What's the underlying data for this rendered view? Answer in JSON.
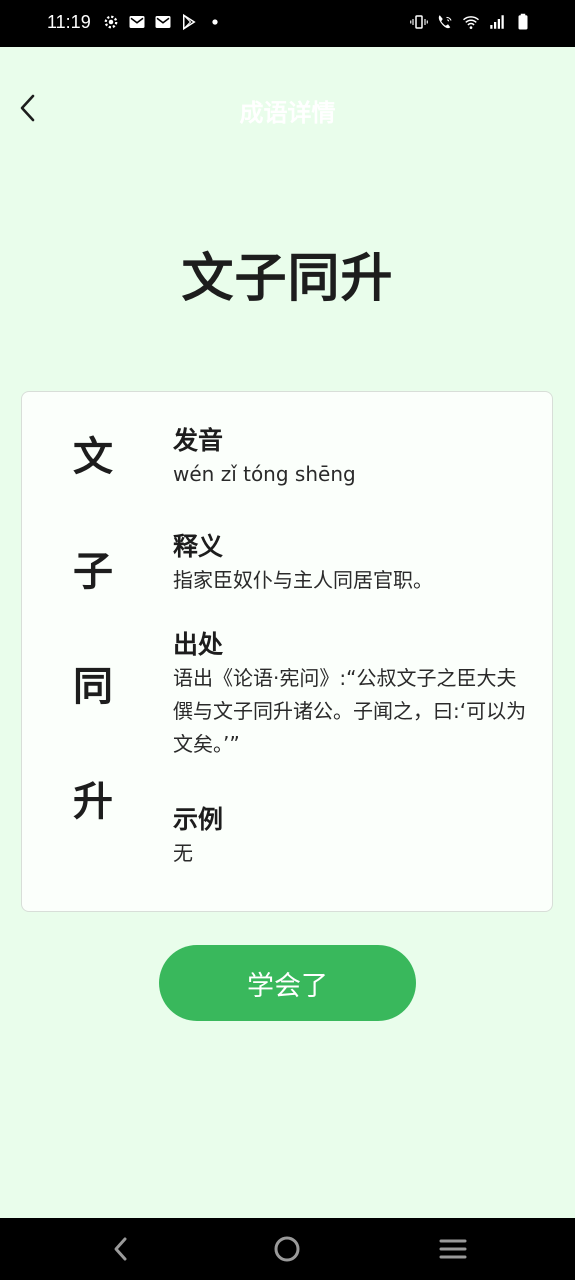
{
  "status_bar": {
    "time": "11:19",
    "left_icons": [
      "gear-icon",
      "mail-icon",
      "mail-icon",
      "play-store-icon",
      "dot-icon"
    ],
    "right_icons": [
      "vibrate-icon",
      "wifi-call-icon",
      "wifi-icon",
      "signal-icon",
      "battery-icon"
    ]
  },
  "header": {
    "title": "成语详情"
  },
  "idiom": {
    "text": "文子同升",
    "chars": [
      "文",
      "子",
      "同",
      "升"
    ]
  },
  "sections": {
    "pronunciation": {
      "heading": "发音",
      "body": "wén zǐ tóng shēng"
    },
    "meaning": {
      "heading": "释义",
      "body": "指家臣奴仆与主人同居官职。"
    },
    "source": {
      "heading": "出处",
      "body": "语出《论语·宪问》:“公叔文子之臣大夫僎与文子同升诸公。子闻之，曰:‘可以为文矣。’”"
    },
    "example": {
      "heading": "示例",
      "body": "无"
    }
  },
  "button": {
    "label": "学会了"
  },
  "colors": {
    "background": "#e9fdeb",
    "accent": "#39b85c",
    "card": "#fbfffb"
  },
  "nav_bar": {
    "icons": [
      "back-icon",
      "home-icon",
      "recents-icon"
    ]
  }
}
